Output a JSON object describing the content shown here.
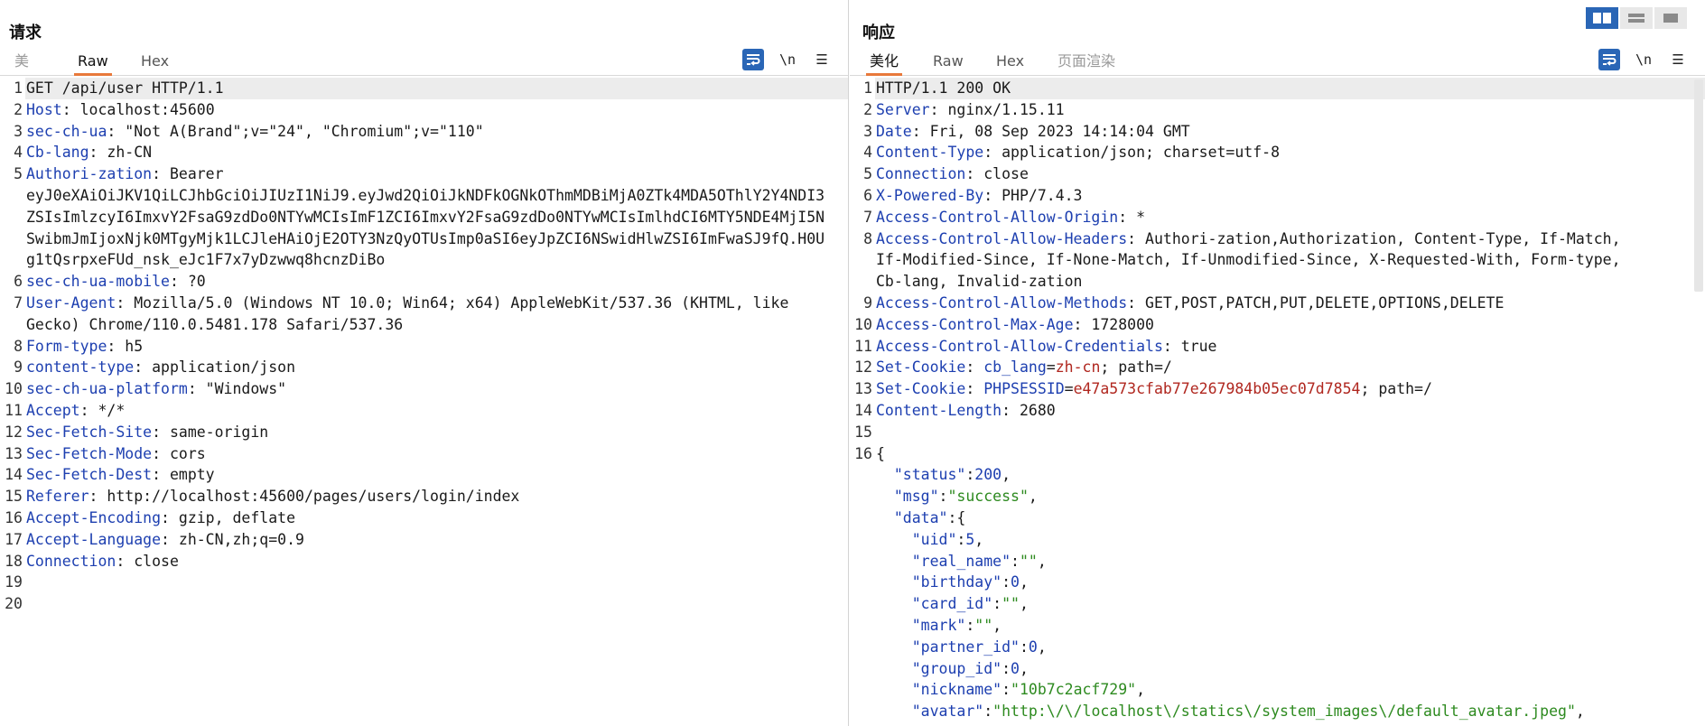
{
  "request": {
    "title": "请求",
    "tabs": [
      {
        "label": "美",
        "state": "muted"
      },
      {
        "label": "Raw",
        "state": "active"
      },
      {
        "label": "Hex",
        "state": "normal"
      }
    ],
    "tools": {
      "newline_label": "\\n",
      "menu_label": "☰"
    },
    "lines": [
      {
        "n": "1",
        "parts": [
          {
            "t": "GET /api/user HTTP/1.1",
            "c": ""
          }
        ]
      },
      {
        "n": "2",
        "parts": [
          {
            "t": "Host",
            "c": "key"
          },
          {
            "t": ": localhost:45600",
            "c": ""
          }
        ]
      },
      {
        "n": "3",
        "parts": [
          {
            "t": "sec-ch-ua",
            "c": "key"
          },
          {
            "t": ": \"Not A(Brand\";v=\"24\", \"Chromium\";v=\"110\"",
            "c": ""
          }
        ]
      },
      {
        "n": "4",
        "parts": [
          {
            "t": "Cb-lang",
            "c": "key"
          },
          {
            "t": ": zh-CN",
            "c": ""
          }
        ]
      },
      {
        "n": "5",
        "parts": [
          {
            "t": "Authori-zation",
            "c": "key"
          },
          {
            "t": ": Bearer",
            "c": ""
          }
        ]
      },
      {
        "n": "",
        "parts": [
          {
            "t": "eyJ0eXAiOiJKV1QiLCJhbGciOiJIUzI1NiJ9.eyJwd2QiOiJkNDFkOGNkOThmMDBiMjA0ZTk4MDA5OThlY2Y4NDI3",
            "c": ""
          }
        ]
      },
      {
        "n": "",
        "parts": [
          {
            "t": "ZSIsImlzcyI6ImxvY2FsaG9zdDo0NTYwMCIsImF1ZCI6ImxvY2FsaG9zdDo0NTYwMCIsImlhdCI6MTY5NDE4MjI5N",
            "c": ""
          }
        ]
      },
      {
        "n": "",
        "parts": [
          {
            "t": "SwibmJmIjoxNjk0MTgyMjk1LCJleHAiOjE2OTY3NzQyOTUsImp0aSI6eyJpZCI6NSwidHlwZSI6ImFwaSJ9fQ.H0U",
            "c": ""
          }
        ]
      },
      {
        "n": "",
        "parts": [
          {
            "t": "g1tQsrpxeFUd_nsk_eJc1F7x7yDzwwq8hcnzDiBo",
            "c": ""
          }
        ]
      },
      {
        "n": "6",
        "parts": [
          {
            "t": "sec-ch-ua-mobile",
            "c": "key"
          },
          {
            "t": ": ?0",
            "c": ""
          }
        ]
      },
      {
        "n": "7",
        "parts": [
          {
            "t": "User-Agent",
            "c": "key"
          },
          {
            "t": ": Mozilla/5.0 (Windows NT 10.0; Win64; x64) AppleWebKit/537.36 (KHTML, like",
            "c": ""
          }
        ]
      },
      {
        "n": "",
        "parts": [
          {
            "t": "Gecko) Chrome/110.0.5481.178 Safari/537.36",
            "c": ""
          }
        ]
      },
      {
        "n": "8",
        "parts": [
          {
            "t": "Form-type",
            "c": "key"
          },
          {
            "t": ": h5",
            "c": ""
          }
        ]
      },
      {
        "n": "9",
        "parts": [
          {
            "t": "content-type",
            "c": "key"
          },
          {
            "t": ": application/json",
            "c": ""
          }
        ]
      },
      {
        "n": "10",
        "parts": [
          {
            "t": "sec-ch-ua-platform",
            "c": "key"
          },
          {
            "t": ": \"Windows\"",
            "c": ""
          }
        ]
      },
      {
        "n": "11",
        "parts": [
          {
            "t": "Accept",
            "c": "key"
          },
          {
            "t": ": */*",
            "c": ""
          }
        ]
      },
      {
        "n": "12",
        "parts": [
          {
            "t": "Sec-Fetch-Site",
            "c": "key"
          },
          {
            "t": ": same-origin",
            "c": ""
          }
        ]
      },
      {
        "n": "13",
        "parts": [
          {
            "t": "Sec-Fetch-Mode",
            "c": "key"
          },
          {
            "t": ": cors",
            "c": ""
          }
        ]
      },
      {
        "n": "14",
        "parts": [
          {
            "t": "Sec-Fetch-Dest",
            "c": "key"
          },
          {
            "t": ": empty",
            "c": ""
          }
        ]
      },
      {
        "n": "15",
        "parts": [
          {
            "t": "Referer",
            "c": "key"
          },
          {
            "t": ": http://localhost:45600/pages/users/login/index",
            "c": ""
          }
        ]
      },
      {
        "n": "16",
        "parts": [
          {
            "t": "Accept-Encoding",
            "c": "key"
          },
          {
            "t": ": gzip, deflate",
            "c": ""
          }
        ]
      },
      {
        "n": "17",
        "parts": [
          {
            "t": "Accept-Language",
            "c": "key"
          },
          {
            "t": ": zh-CN,zh;q=0.9",
            "c": ""
          }
        ]
      },
      {
        "n": "18",
        "parts": [
          {
            "t": "Connection",
            "c": "key"
          },
          {
            "t": ": close",
            "c": ""
          }
        ]
      },
      {
        "n": "19",
        "parts": [
          {
            "t": "",
            "c": ""
          }
        ]
      },
      {
        "n": "20",
        "parts": [
          {
            "t": "",
            "c": ""
          }
        ]
      }
    ]
  },
  "response": {
    "title": "响应",
    "tabs": [
      {
        "label": "美化",
        "state": "active"
      },
      {
        "label": "Raw",
        "state": "normal"
      },
      {
        "label": "Hex",
        "state": "normal"
      },
      {
        "label": "页面渲染",
        "state": "muted"
      }
    ],
    "tools": {
      "newline_label": "\\n",
      "menu_label": "☰"
    },
    "lines": [
      {
        "n": "1",
        "parts": [
          {
            "t": "HTTP/1.1 200 OK",
            "c": ""
          }
        ]
      },
      {
        "n": "2",
        "parts": [
          {
            "t": "Server",
            "c": "key"
          },
          {
            "t": ": nginx/1.15.11",
            "c": ""
          }
        ]
      },
      {
        "n": "3",
        "parts": [
          {
            "t": "Date",
            "c": "key"
          },
          {
            "t": ": Fri, 08 Sep 2023 14:14:04 GMT",
            "c": ""
          }
        ]
      },
      {
        "n": "4",
        "parts": [
          {
            "t": "Content-Type",
            "c": "key"
          },
          {
            "t": ": application/json; charset=utf-8",
            "c": ""
          }
        ]
      },
      {
        "n": "5",
        "parts": [
          {
            "t": "Connection",
            "c": "key"
          },
          {
            "t": ": close",
            "c": ""
          }
        ]
      },
      {
        "n": "6",
        "parts": [
          {
            "t": "X-Powered-By",
            "c": "key"
          },
          {
            "t": ": PHP/7.4.3",
            "c": ""
          }
        ]
      },
      {
        "n": "7",
        "parts": [
          {
            "t": "Access-Control-Allow-Origin",
            "c": "key"
          },
          {
            "t": ": *",
            "c": ""
          }
        ]
      },
      {
        "n": "8",
        "parts": [
          {
            "t": "Access-Control-Allow-Headers",
            "c": "key"
          },
          {
            "t": ": Authori-zation,Authorization, Content-Type, If-Match,",
            "c": ""
          }
        ]
      },
      {
        "n": "",
        "parts": [
          {
            "t": "If-Modified-Since, If-None-Match, If-Unmodified-Since, X-Requested-With, Form-type,",
            "c": ""
          }
        ]
      },
      {
        "n": "",
        "parts": [
          {
            "t": "Cb-lang, Invalid-zation",
            "c": ""
          }
        ]
      },
      {
        "n": "9",
        "parts": [
          {
            "t": "Access-Control-Allow-Methods",
            "c": "key"
          },
          {
            "t": ": GET,POST,PATCH,PUT,DELETE,OPTIONS,DELETE",
            "c": ""
          }
        ]
      },
      {
        "n": "10",
        "parts": [
          {
            "t": "Access-Control-Max-Age",
            "c": "key"
          },
          {
            "t": ": 1728000",
            "c": ""
          }
        ]
      },
      {
        "n": "11",
        "parts": [
          {
            "t": "Access-Control-Allow-Credentials",
            "c": "key"
          },
          {
            "t": ": true",
            "c": ""
          }
        ]
      },
      {
        "n": "12",
        "parts": [
          {
            "t": "Set-Cookie",
            "c": "key"
          },
          {
            "t": ": ",
            "c": ""
          },
          {
            "t": "cb_lang",
            "c": "ck"
          },
          {
            "t": "=",
            "c": ""
          },
          {
            "t": "zh-cn",
            "c": "cv"
          },
          {
            "t": "; path=/",
            "c": ""
          }
        ]
      },
      {
        "n": "13",
        "parts": [
          {
            "t": "Set-Cookie",
            "c": "key"
          },
          {
            "t": ": ",
            "c": ""
          },
          {
            "t": "PHPSESSID",
            "c": "ck"
          },
          {
            "t": "=",
            "c": ""
          },
          {
            "t": "e47a573cfab77e267984b05ec07d7854",
            "c": "cv"
          },
          {
            "t": "; path=/",
            "c": ""
          }
        ]
      },
      {
        "n": "14",
        "parts": [
          {
            "t": "Content-Length",
            "c": "key"
          },
          {
            "t": ": 2680",
            "c": ""
          }
        ]
      },
      {
        "n": "15",
        "parts": [
          {
            "t": "",
            "c": ""
          }
        ]
      },
      {
        "n": "16",
        "parts": [
          {
            "t": "{",
            "c": ""
          }
        ]
      },
      {
        "n": "",
        "parts": [
          {
            "t": "  ",
            "c": ""
          },
          {
            "t": "\"status\"",
            "c": "jkey"
          },
          {
            "t": ":",
            "c": ""
          },
          {
            "t": "200",
            "c": "jnum"
          },
          {
            "t": ",",
            "c": ""
          }
        ]
      },
      {
        "n": "",
        "parts": [
          {
            "t": "  ",
            "c": ""
          },
          {
            "t": "\"msg\"",
            "c": "jkey"
          },
          {
            "t": ":",
            "c": ""
          },
          {
            "t": "\"success\"",
            "c": "jstr"
          },
          {
            "t": ",",
            "c": ""
          }
        ]
      },
      {
        "n": "",
        "parts": [
          {
            "t": "  ",
            "c": ""
          },
          {
            "t": "\"data\"",
            "c": "jkey"
          },
          {
            "t": ":{",
            "c": ""
          }
        ]
      },
      {
        "n": "",
        "parts": [
          {
            "t": "    ",
            "c": ""
          },
          {
            "t": "\"uid\"",
            "c": "jkey"
          },
          {
            "t": ":",
            "c": ""
          },
          {
            "t": "5",
            "c": "jnum"
          },
          {
            "t": ",",
            "c": ""
          }
        ]
      },
      {
        "n": "",
        "parts": [
          {
            "t": "    ",
            "c": ""
          },
          {
            "t": "\"real_name\"",
            "c": "jkey"
          },
          {
            "t": ":",
            "c": ""
          },
          {
            "t": "\"\"",
            "c": "jstr"
          },
          {
            "t": ",",
            "c": ""
          }
        ]
      },
      {
        "n": "",
        "parts": [
          {
            "t": "    ",
            "c": ""
          },
          {
            "t": "\"birthday\"",
            "c": "jkey"
          },
          {
            "t": ":",
            "c": ""
          },
          {
            "t": "0",
            "c": "jnum"
          },
          {
            "t": ",",
            "c": ""
          }
        ]
      },
      {
        "n": "",
        "parts": [
          {
            "t": "    ",
            "c": ""
          },
          {
            "t": "\"card_id\"",
            "c": "jkey"
          },
          {
            "t": ":",
            "c": ""
          },
          {
            "t": "\"\"",
            "c": "jstr"
          },
          {
            "t": ",",
            "c": ""
          }
        ]
      },
      {
        "n": "",
        "parts": [
          {
            "t": "    ",
            "c": ""
          },
          {
            "t": "\"mark\"",
            "c": "jkey"
          },
          {
            "t": ":",
            "c": ""
          },
          {
            "t": "\"\"",
            "c": "jstr"
          },
          {
            "t": ",",
            "c": ""
          }
        ]
      },
      {
        "n": "",
        "parts": [
          {
            "t": "    ",
            "c": ""
          },
          {
            "t": "\"partner_id\"",
            "c": "jkey"
          },
          {
            "t": ":",
            "c": ""
          },
          {
            "t": "0",
            "c": "jnum"
          },
          {
            "t": ",",
            "c": ""
          }
        ]
      },
      {
        "n": "",
        "parts": [
          {
            "t": "    ",
            "c": ""
          },
          {
            "t": "\"group_id\"",
            "c": "jkey"
          },
          {
            "t": ":",
            "c": ""
          },
          {
            "t": "0",
            "c": "jnum"
          },
          {
            "t": ",",
            "c": ""
          }
        ]
      },
      {
        "n": "",
        "parts": [
          {
            "t": "    ",
            "c": ""
          },
          {
            "t": "\"nickname\"",
            "c": "jkey"
          },
          {
            "t": ":",
            "c": ""
          },
          {
            "t": "\"10b7c2acf729\"",
            "c": "jstr"
          },
          {
            "t": ",",
            "c": ""
          }
        ]
      },
      {
        "n": "",
        "parts": [
          {
            "t": "    ",
            "c": ""
          },
          {
            "t": "\"avatar\"",
            "c": "jkey"
          },
          {
            "t": ":",
            "c": ""
          },
          {
            "t": "\"http:\\/\\/localhost\\/statics\\/system_images\\/default_avatar.jpeg\"",
            "c": "jstr"
          },
          {
            "t": ",",
            "c": ""
          }
        ]
      }
    ]
  },
  "colors": {
    "accent": "#2a66b6",
    "tab_active_underline": "#e8793a",
    "header_key": "#1d3fb0",
    "json_string": "#2d8a1f",
    "cookie_value": "#b0271f"
  }
}
